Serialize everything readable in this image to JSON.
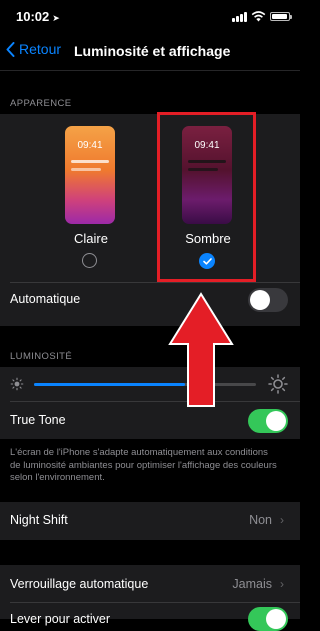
{
  "status_bar": {
    "time": "10:02"
  },
  "nav": {
    "back_label": "Retour",
    "title": "Luminosité et affichage"
  },
  "appearance": {
    "header": "APPARENCE",
    "options": [
      {
        "label": "Claire",
        "preview_time": "09:41",
        "selected": false
      },
      {
        "label": "Sombre",
        "preview_time": "09:41",
        "selected": true
      }
    ],
    "automatic_label": "Automatique",
    "automatic_on": false
  },
  "brightness": {
    "header": "LUMINOSITÉ",
    "level_percent": 68,
    "true_tone_label": "True Tone",
    "true_tone_on": true,
    "footnote": "L'écran de l'iPhone s'adapte automatiquement aux conditions de luminosité ambiantes pour optimiser l'affichage des couleurs selon l'environnement."
  },
  "night_shift": {
    "label": "Night Shift",
    "value": "Non"
  },
  "auto_lock": {
    "label": "Verrouillage automatique",
    "value": "Jamais"
  },
  "raise_to_wake": {
    "label": "Lever pour activer",
    "on": true
  },
  "colors": {
    "accent": "#0a84ff",
    "toggle_on": "#34c759",
    "annotation": "#e41e26"
  }
}
